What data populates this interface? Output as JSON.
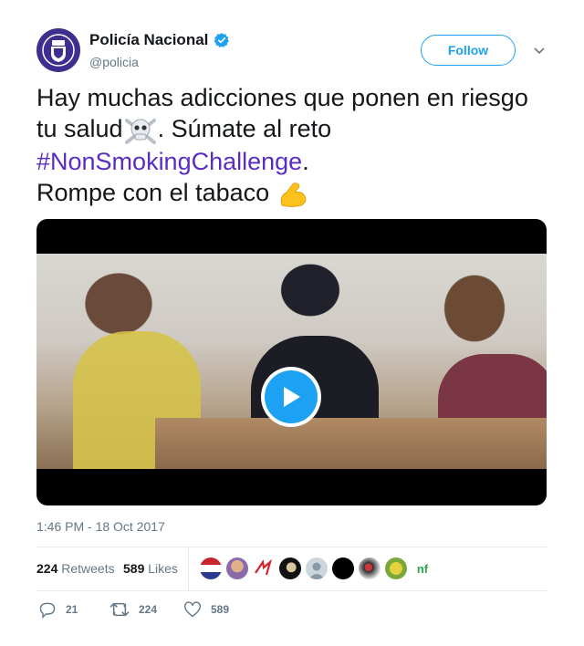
{
  "author": {
    "display_name": "Policía Nacional",
    "handle": "@policia",
    "verified": true
  },
  "follow_label": "Follow",
  "tweet": {
    "line1": "Hay muchas adicciones que ponen en riesgo",
    "line2a": "tu salud",
    "line2b": ". Súmate al reto",
    "hashtag": "#NonSmokingChallenge",
    "line3_tail": ".",
    "line4": "Rompe con el tabaco",
    "emoji_1": "skull-crossbones-icon",
    "emoji_2": "flexed-biceps-icon"
  },
  "timestamp": "1:46 PM - 18 Oct 2017",
  "stats": {
    "retweets_count": "224",
    "retweets_label": "Retweets",
    "likes_count": "589",
    "likes_label": "Likes"
  },
  "liker_avatar_text": "nf",
  "actions": {
    "replies": "21",
    "retweets": "224",
    "likes": "589"
  },
  "colors": {
    "accent": "#1da1f2",
    "hashtag": "#5b2cc4",
    "muted": "#657786"
  }
}
